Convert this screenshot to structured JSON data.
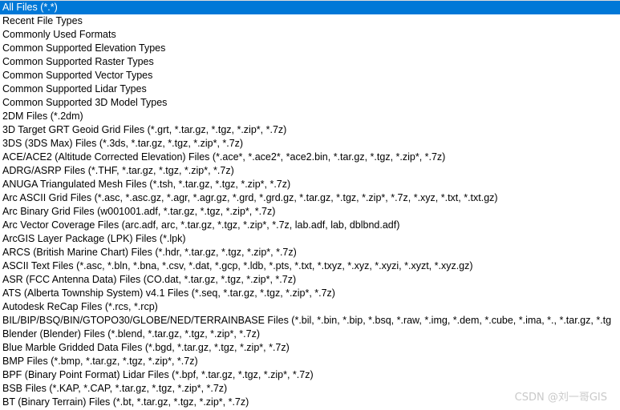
{
  "file_type_list": {
    "items": [
      {
        "label": "All Files (*.*)",
        "selected": true
      },
      {
        "label": "Recent File Types"
      },
      {
        "label": "Commonly Used Formats"
      },
      {
        "label": "Common Supported Elevation Types"
      },
      {
        "label": "Common Supported Raster Types"
      },
      {
        "label": "Common Supported Vector Types"
      },
      {
        "label": "Common Supported Lidar Types"
      },
      {
        "label": "Common Supported 3D Model Types"
      },
      {
        "label": "2DM Files (*.2dm)"
      },
      {
        "label": "3D Target GRT Geoid Grid Files (*.grt, *.tar.gz, *.tgz, *.zip*, *.7z)"
      },
      {
        "label": "3DS (3DS Max) Files (*.3ds, *.tar.gz, *.tgz, *.zip*, *.7z)"
      },
      {
        "label": "ACE/ACE2 (Altitude Corrected Elevation) Files (*.ace*, *.ace2*, *ace2.bin, *.tar.gz, *.tgz, *.zip*, *.7z)"
      },
      {
        "label": "ADRG/ASRP Files (*.THF, *.tar.gz, *.tgz, *.zip*, *.7z)"
      },
      {
        "label": "ANUGA Triangulated Mesh Files (*.tsh, *.tar.gz, *.tgz, *.zip*, *.7z)"
      },
      {
        "label": "Arc ASCII Grid Files (*.asc, *.asc.gz, *.agr, *.agr.gz, *.grd, *.grd.gz, *.tar.gz, *.tgz, *.zip*, *.7z, *.xyz, *.txt, *.txt.gz)"
      },
      {
        "label": "Arc Binary Grid Files (w001001.adf, *.tar.gz, *.tgz, *.zip*, *.7z)"
      },
      {
        "label": "Arc Vector Coverage Files (arc.adf, arc, *.tar.gz, *.tgz, *.zip*, *.7z, lab.adf, lab, dblbnd.adf)"
      },
      {
        "label": "ArcGIS Layer Package (LPK) Files (*.lpk)"
      },
      {
        "label": "ARCS (British Marine Chart) Files (*.hdr, *.tar.gz, *.tgz, *.zip*, *.7z)"
      },
      {
        "label": "ASCII Text Files (*.asc, *.bln, *.bna, *.csv, *.dat, *.gcp, *.ldb, *.pts, *.txt, *.txyz, *.xyz, *.xyzi, *.xyzt, *.xyz.gz)"
      },
      {
        "label": "ASR (FCC Antenna Data) Files (CO.dat, *.tar.gz, *.tgz, *.zip*, *.7z)"
      },
      {
        "label": "ATS (Alberta Township System) v4.1 Files (*.seq, *.tar.gz, *.tgz, *.zip*, *.7z)"
      },
      {
        "label": "Autodesk ReCap Files (*.rcs, *.rcp)"
      },
      {
        "label": "BIL/BIP/BSQ/BIN/GTOPO30/GLOBE/NED/TERRAINBASE Files (*.bil, *.bin, *.bip, *.bsq, *.raw, *.img, *.dem, *.cube, *.ima, *., *.tar.gz, *.tg"
      },
      {
        "label": "Blender (Blender) Files (*.blend, *.tar.gz, *.tgz, *.zip*, *.7z)"
      },
      {
        "label": "Blue Marble Gridded Data Files (*.bgd, *.tar.gz, *.tgz, *.zip*, *.7z)"
      },
      {
        "label": "BMP Files (*.bmp, *.tar.gz, *.tgz, *.zip*, *.7z)"
      },
      {
        "label": "BPF (Binary Point Format) Lidar Files (*.bpf, *.tar.gz, *.tgz, *.zip*, *.7z)"
      },
      {
        "label": "BSB Files (*.KAP, *.CAP, *.tar.gz, *.tgz, *.zip*, *.7z)"
      },
      {
        "label": "BT (Binary Terrain) Files (*.bt, *.tar.gz, *.tgz, *.zip*, *.7z)"
      }
    ]
  },
  "watermark": "CSDN @刘一哥GIS"
}
